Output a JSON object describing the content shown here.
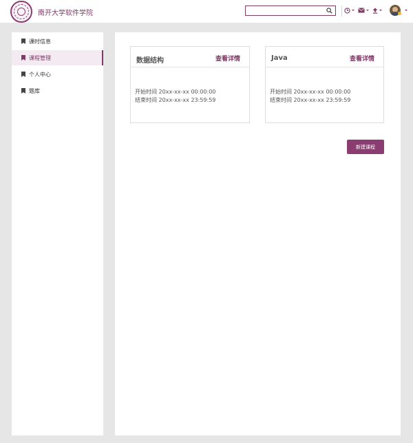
{
  "header": {
    "site_title": "南开大学软件学院",
    "search": {
      "value": "",
      "placeholder": ""
    },
    "icons": [
      "clock-icon",
      "mail-icon",
      "upload-icon"
    ],
    "accent_color": "#7d3b66"
  },
  "sidebar": {
    "items": [
      {
        "label": "课时信息",
        "active": false
      },
      {
        "label": "课程管理",
        "active": true
      },
      {
        "label": "个人中心",
        "active": false
      },
      {
        "label": "题库",
        "active": false
      }
    ]
  },
  "main": {
    "courses": [
      {
        "title": "数据结构",
        "link": "查看详情",
        "start": "开始时间 20xx-xx-xx 00:00:00",
        "end": "结束时间 20xx-xx-xx 23:59:59"
      },
      {
        "title": "Java",
        "link": "查看详情",
        "start": "开始时间 20xx-xx-xx 00:00:00",
        "end": "结束时间 20xx-xx-xx 23:59:59"
      }
    ],
    "new_course_label": "新建课程"
  }
}
